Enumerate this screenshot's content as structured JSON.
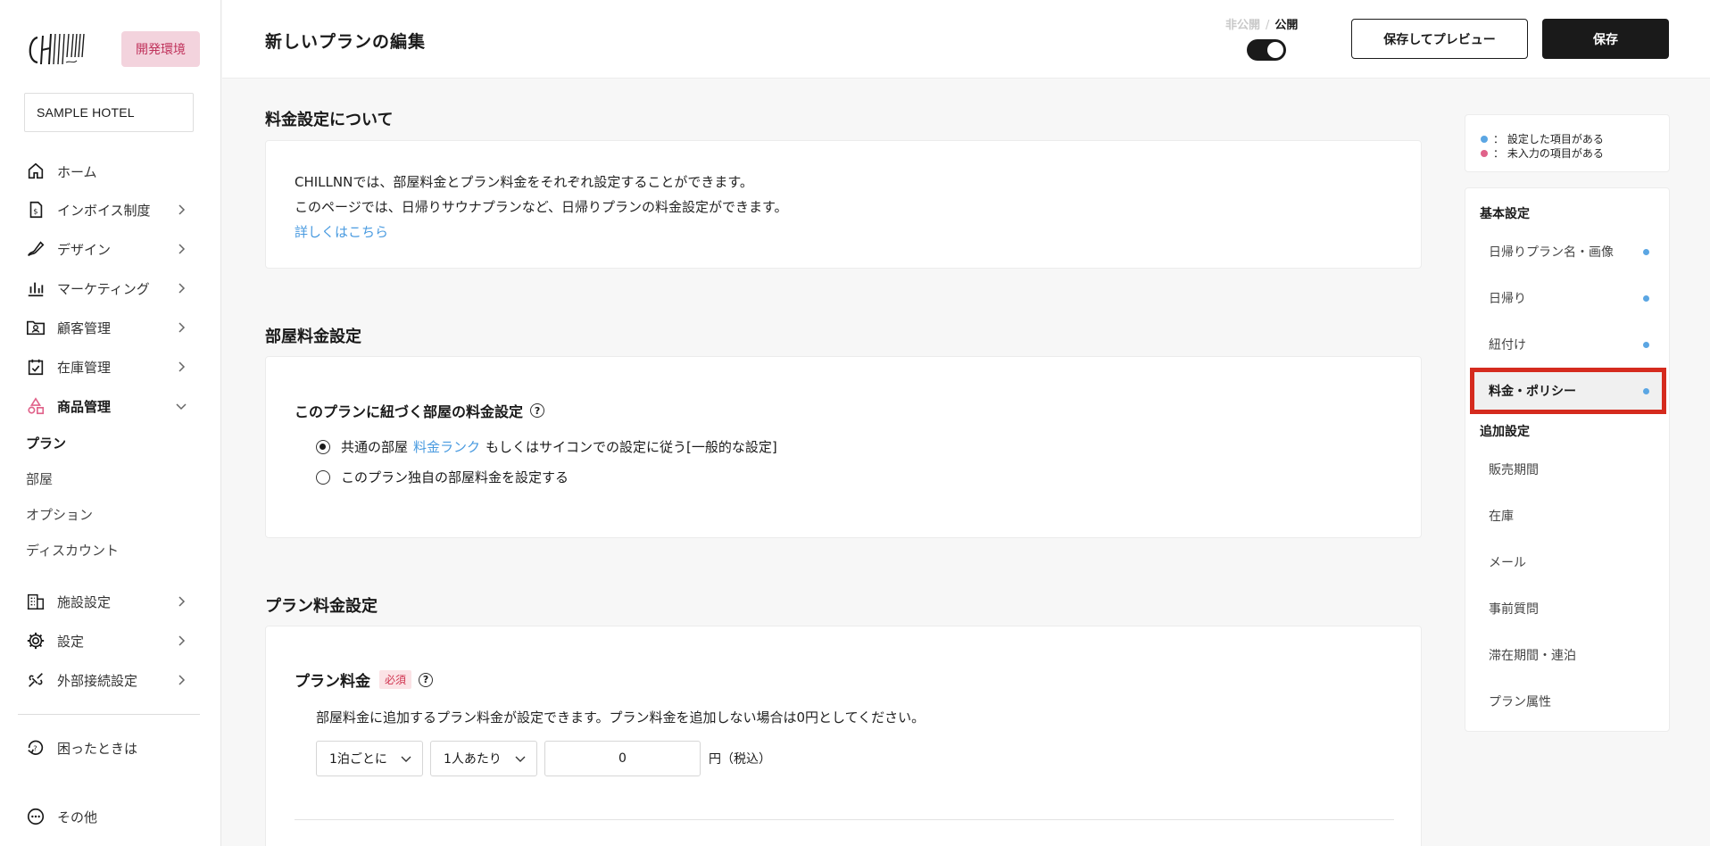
{
  "sidebar": {
    "env_badge": "開発環境",
    "hotel": "SAMPLE HOTEL",
    "nav": [
      {
        "label": "ホーム",
        "icon": "home-icon"
      },
      {
        "label": "インボイス制度",
        "icon": "invoice-icon"
      },
      {
        "label": "デザイン",
        "icon": "design-icon"
      },
      {
        "label": "マーケティング",
        "icon": "chart-icon"
      },
      {
        "label": "顧客管理",
        "icon": "customer-icon"
      },
      {
        "label": "在庫管理",
        "icon": "inventory-icon"
      },
      {
        "label": "商品管理",
        "icon": "shapes-icon"
      }
    ],
    "sub": [
      "プラン",
      "部屋",
      "オプション",
      "ディスカウント"
    ],
    "nav2": [
      {
        "label": "施設設定",
        "icon": "building-icon"
      },
      {
        "label": "設定",
        "icon": "gear-icon"
      },
      {
        "label": "外部接続設定",
        "icon": "connection-icon"
      }
    ],
    "help": "困ったときは",
    "other": "その他"
  },
  "header": {
    "title": "新しいプランの編集",
    "unpublished": "非公開",
    "separator": "/",
    "published": "公開",
    "preview_button": "保存してプレビュー",
    "save_button": "保存"
  },
  "main": {
    "about": {
      "title": "料金設定について",
      "line1": "CHILLNNでは、部屋料金とプラン料金をそれぞれ設定することができます。",
      "line2": "このページでは、日帰りサウナプランなど、日帰りプランの料金設定ができます。",
      "link": "詳しくはこちら"
    },
    "room": {
      "title": "部屋料金設定",
      "subtitle": "このプランに紐づく部屋の料金設定",
      "help": "?",
      "option1_pre": "共通の部屋",
      "option1_link": "料金ランク",
      "option1_post": "もしくはサイコンでの設定に従う[一般的な設定]",
      "option2": "このプラン独自の部屋料金を設定する"
    },
    "plan": {
      "title": "プラン料金設定",
      "subtitle": "プラン料金",
      "required": "必須",
      "help": "?",
      "description": "部屋料金に追加するプラン料金が設定できます。プラン料金を追加しない場合は0円としてください。",
      "per_night": "1泊ごとに",
      "per_person": "1人あたり",
      "price_value": "0",
      "unit": "円（税込）"
    }
  },
  "legend": {
    "set": "：  設定した項目がある",
    "unset": "：  未入力の項目がある",
    "set_color": "#5ba6e3",
    "unset_color": "#e0628a"
  },
  "toc": {
    "basic_head": "基本設定",
    "basic": [
      "日帰りプラン名・画像",
      "日帰り",
      "紐付け",
      "料金・ポリシー"
    ],
    "extra_head": "追加設定",
    "extra": [
      "販売期間",
      "在庫",
      "メール",
      "事前質問",
      "滞在期間・連泊",
      "プラン属性"
    ]
  }
}
